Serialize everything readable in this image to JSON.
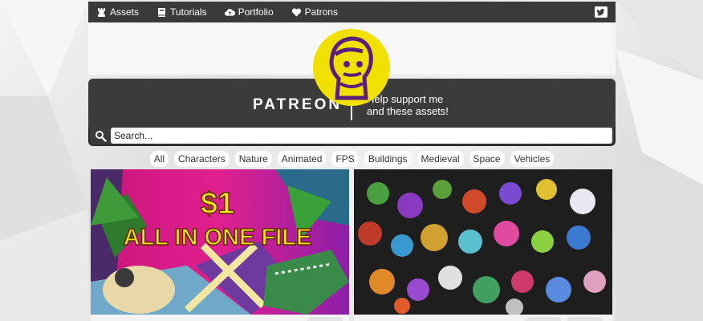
{
  "nav": {
    "items": [
      {
        "label": "Assets",
        "icon": "chess-rook-icon"
      },
      {
        "label": "Tutorials",
        "icon": "book-icon"
      },
      {
        "label": "Portfolio",
        "icon": "cloud-upload-icon"
      },
      {
        "label": "Patrons",
        "icon": "heart-icon"
      }
    ],
    "social_icon": "twitter-icon"
  },
  "banner": {
    "brand": "PATREON",
    "support_line1": "Help support me",
    "support_line2": "and these assets!"
  },
  "search": {
    "placeholder": "Search..."
  },
  "filters": [
    "All",
    "Characters",
    "Nature",
    "Animated",
    "FPS",
    "Buildings",
    "Medieval",
    "Space",
    "Vehicles"
  ],
  "cards": [
    {
      "image_text_top": "$1",
      "image_text_bottom": "ALL IN ONE FILE"
    },
    {}
  ],
  "colors": {
    "nav_bg": "#3a3a3a",
    "logo_yellow": "#f2e100",
    "logo_purple": "#5a1f7a",
    "banner_bg": "#3b3b3b",
    "card1_magenta": "#d01a8a",
    "headline_yellow": "#ffe41a"
  }
}
